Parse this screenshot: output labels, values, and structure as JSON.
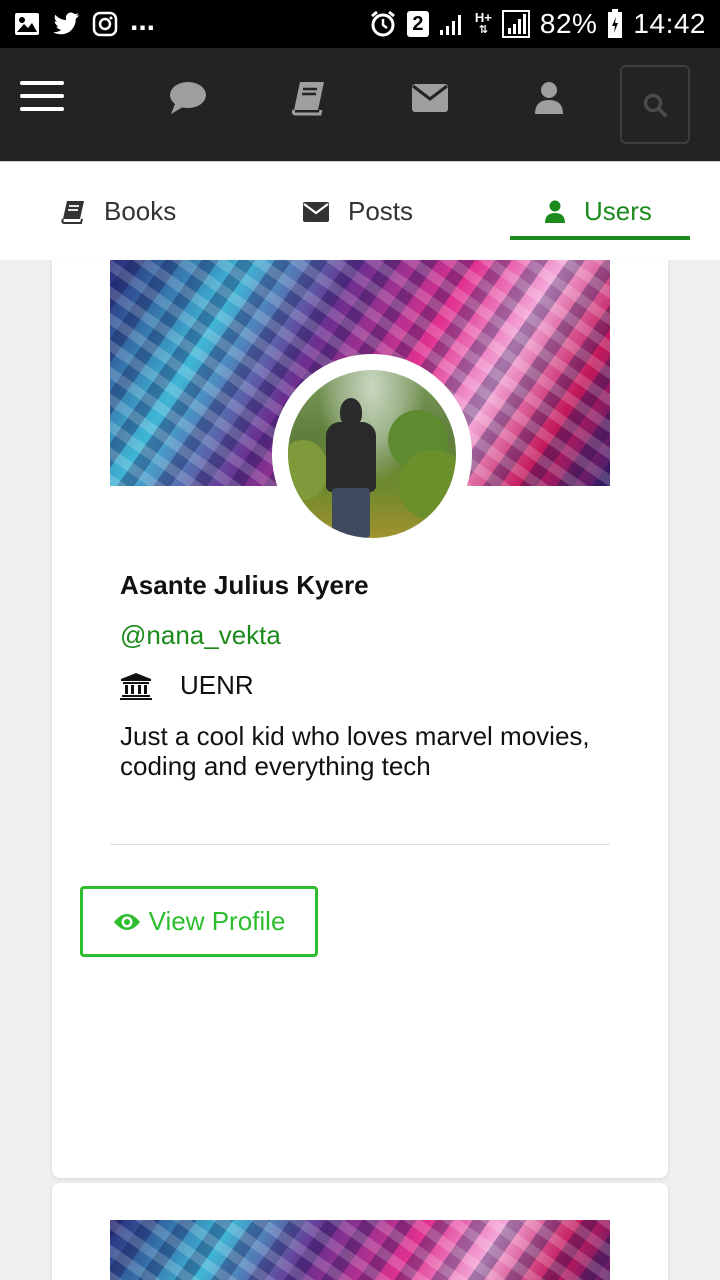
{
  "status_bar": {
    "icons_left": [
      "image-icon",
      "twitter-icon",
      "instagram-icon"
    ],
    "more": "...",
    "notification_count": "2",
    "network_label": "H+",
    "battery": "82%",
    "time": "14:42"
  },
  "top_nav": {
    "icons": [
      "menu-icon",
      "chat-icon",
      "book-icon",
      "envelope-icon",
      "user-icon",
      "search-icon"
    ]
  },
  "tabs": [
    {
      "label": "Books",
      "icon": "book-icon"
    },
    {
      "label": "Posts",
      "icon": "envelope-icon"
    },
    {
      "label": "Users",
      "icon": "user-icon",
      "active": true
    }
  ],
  "user_card": {
    "name": "Asante Julius Kyere",
    "handle": "@nana_vekta",
    "school": "UENR",
    "bio": "Just a cool kid who loves marvel movies, coding and everything tech",
    "view_profile_label": "View Profile"
  },
  "colors": {
    "accent_green": "#1c8a1c",
    "button_green": "#2ebd2e",
    "nav_bg": "#232323",
    "status_bg": "#000000"
  }
}
